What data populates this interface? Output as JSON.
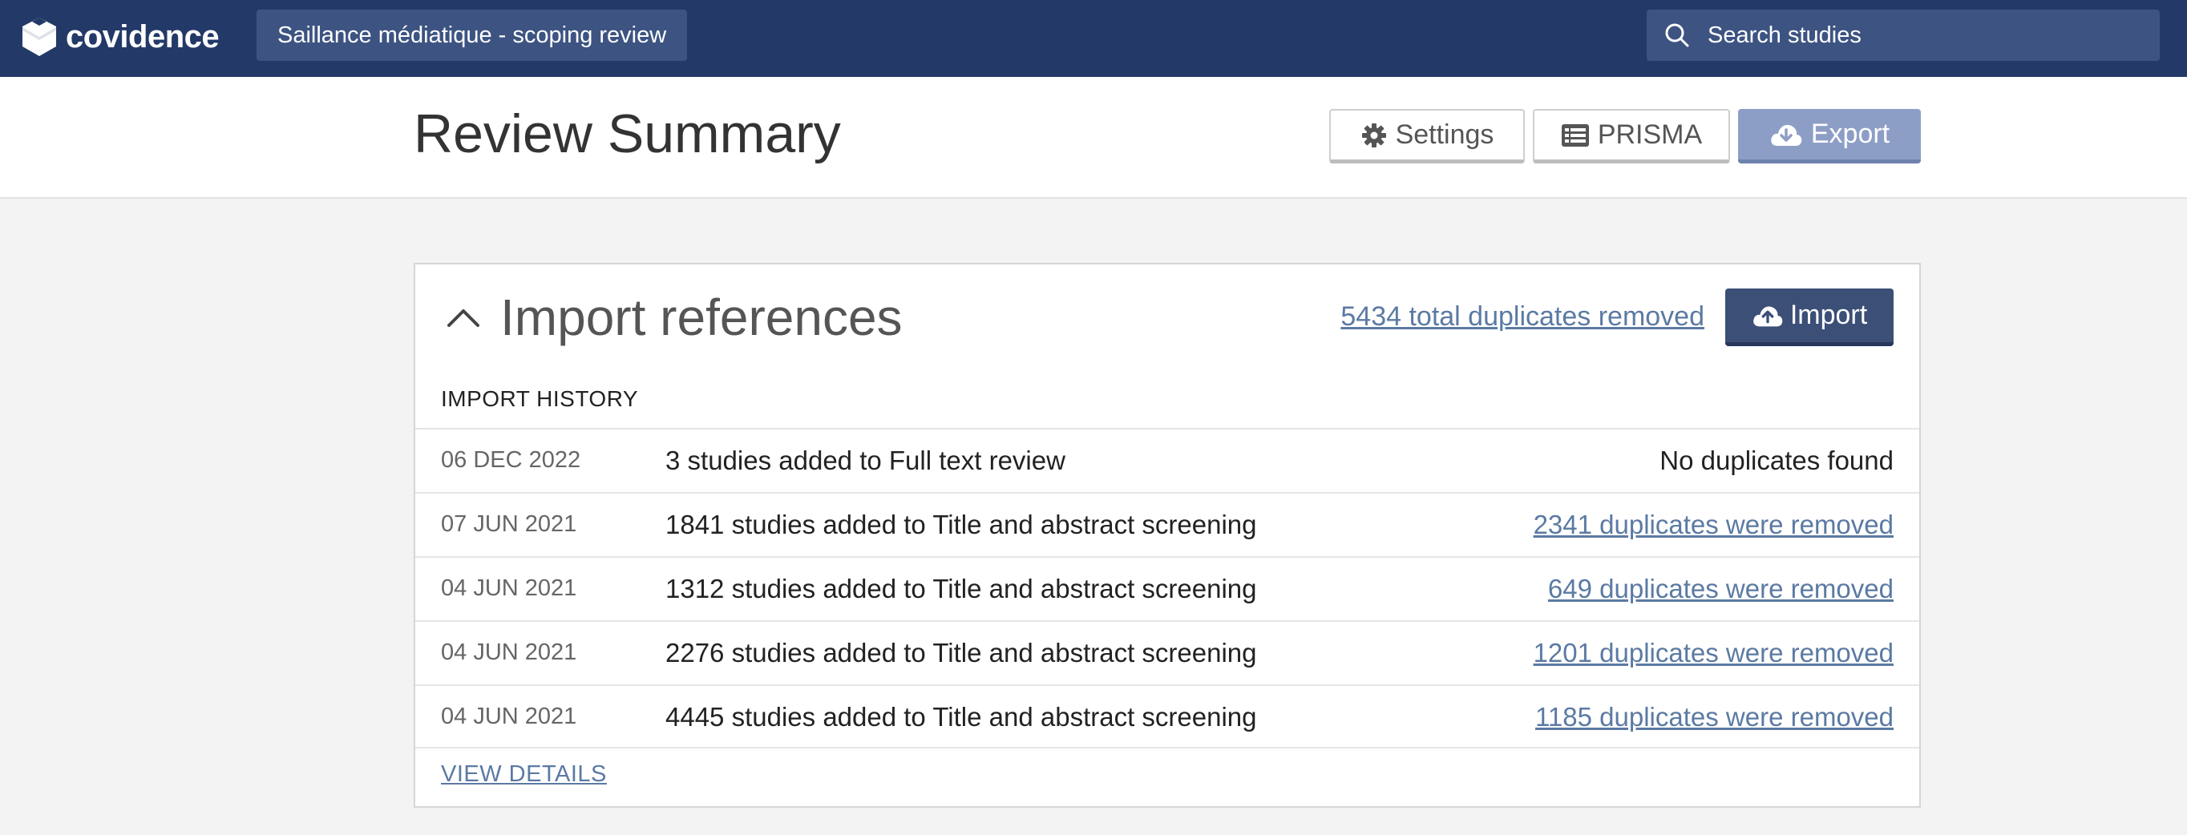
{
  "topbar": {
    "logo_text": "covidence",
    "review_name": "Saillance médiatique - scoping review",
    "search_placeholder": "Search studies"
  },
  "header": {
    "title": "Review Summary",
    "settings_label": "Settings",
    "prisma_label": "PRISMA",
    "export_label": "Export"
  },
  "import_card": {
    "title": "Import references",
    "total_duplicates": "5434 total duplicates removed",
    "import_label": "Import",
    "history_label": "IMPORT HISTORY",
    "rows": [
      {
        "date": "06 DEC 2022",
        "count": "3",
        "middle": " studies added to ",
        "stage": "Full text review",
        "duplicates": "No duplicates found"
      },
      {
        "date": "07 JUN 2021",
        "count": "1841",
        "middle": " studies added to ",
        "stage": "Title and abstract screening",
        "duplicates": "2341 duplicates were removed"
      },
      {
        "date": "04 JUN 2021",
        "count": "1312",
        "middle": " studies added to ",
        "stage": "Title and abstract screening",
        "duplicates": "649 duplicates were removed"
      },
      {
        "date": "04 JUN 2021",
        "count": "2276",
        "middle": " studies added to ",
        "stage": "Title and abstract screening",
        "duplicates": "1201 duplicates were removed"
      },
      {
        "date": "04 JUN 2021",
        "count": "4445",
        "middle": " studies added to ",
        "stage": "Title and abstract screening",
        "duplicates": "1185 duplicates were removed"
      }
    ],
    "view_details": "VIEW DETAILS"
  },
  "colors": {
    "topbar": "#233a68",
    "link": "#5b7aa3",
    "import_button": "#3b4f77",
    "export_button": "#8d9ec6"
  }
}
